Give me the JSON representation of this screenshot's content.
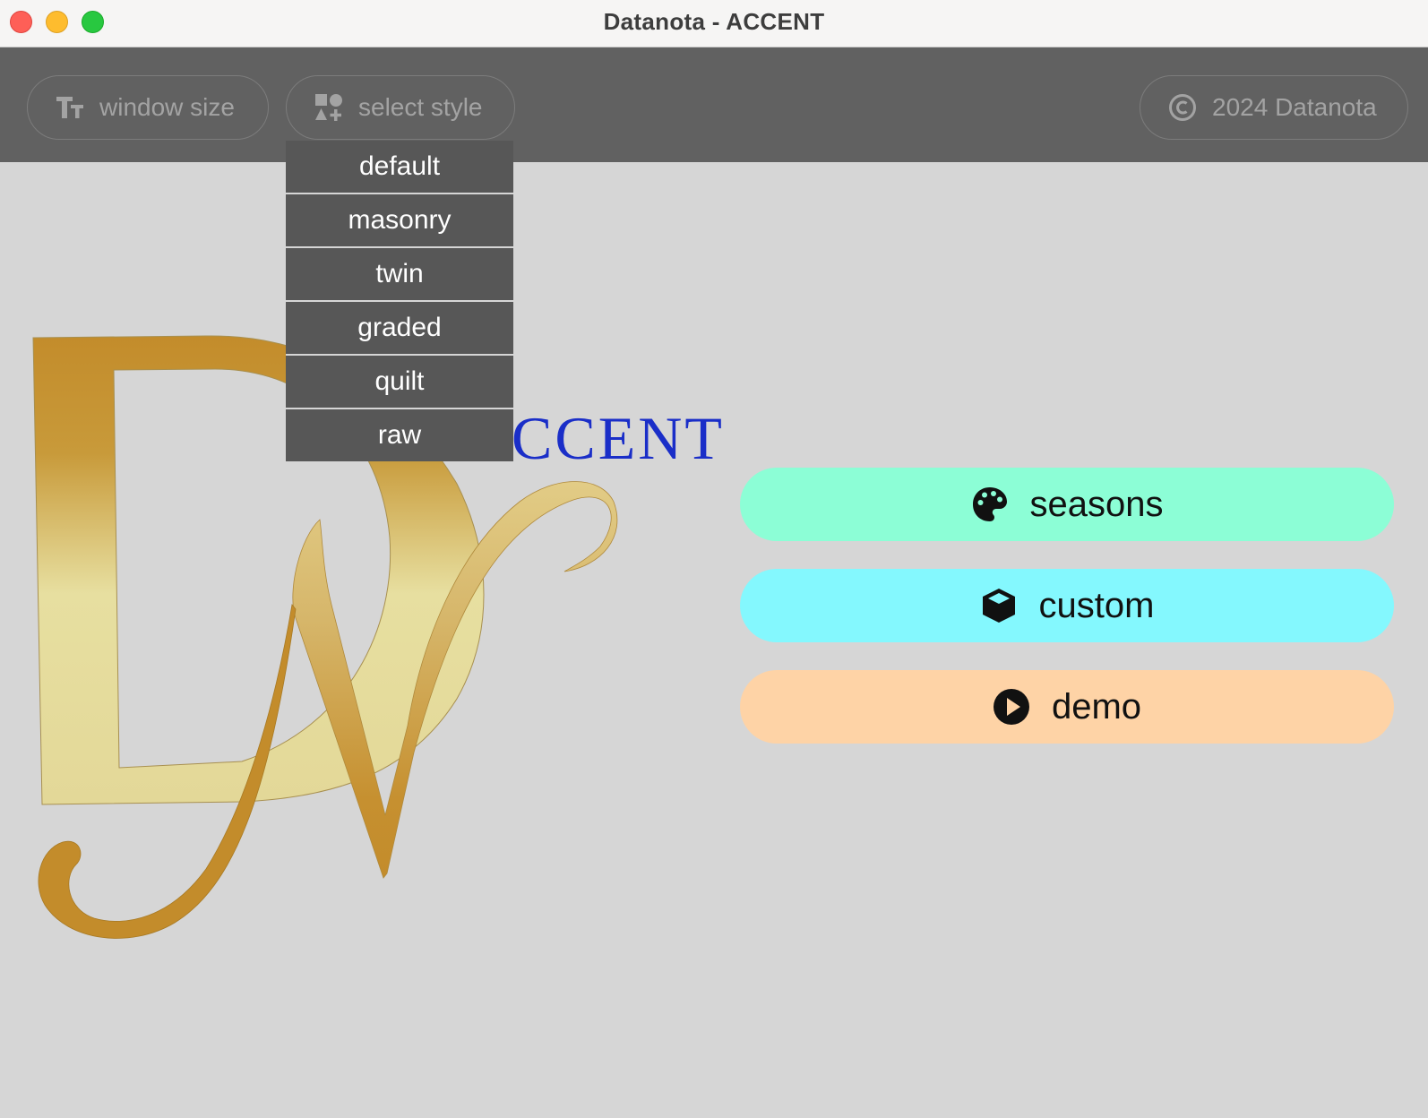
{
  "window": {
    "title": "Datanota - ACCENT"
  },
  "toolbar": {
    "window_size": {
      "label": "window size",
      "icon": "text-size-icon"
    },
    "select_style": {
      "label": "select style",
      "icon": "shapes-icon"
    },
    "copyright": {
      "label": "2024 Datanota",
      "icon": "copyright-icon"
    }
  },
  "style_menu": {
    "items": [
      "default",
      "masonry",
      "twin",
      "graded",
      "quilt",
      "raw"
    ]
  },
  "brand": {
    "wordmark": "CCENT"
  },
  "actions": {
    "seasons": {
      "label": "seasons",
      "icon": "palette-icon",
      "color": "#8cfed6"
    },
    "custom": {
      "label": "custom",
      "icon": "cube-icon",
      "color": "#84f8fe"
    },
    "demo": {
      "label": "demo",
      "icon": "play-circle-icon",
      "color": "#fed3a6"
    }
  }
}
